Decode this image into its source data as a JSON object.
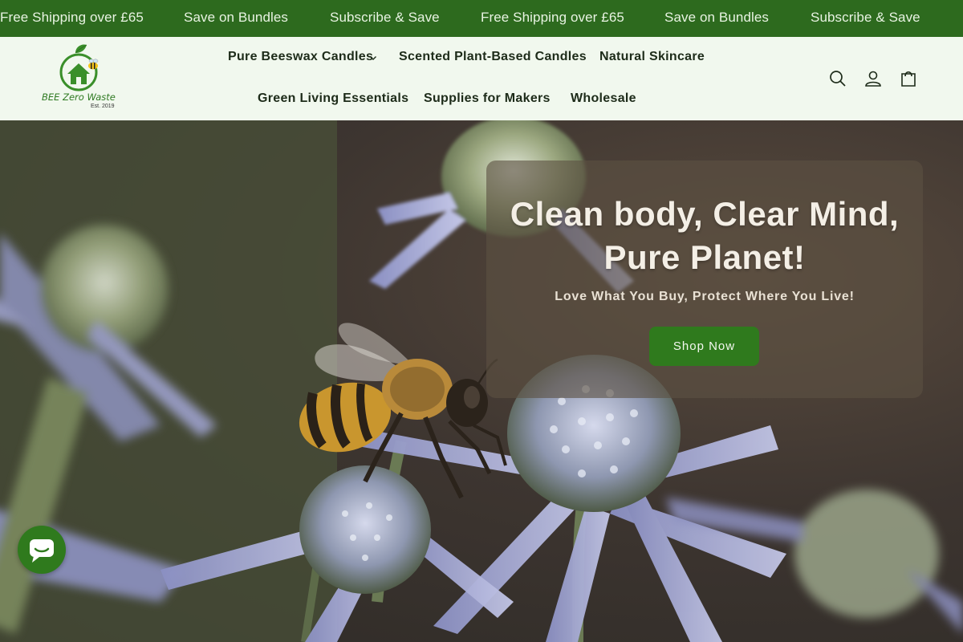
{
  "announcement": {
    "items": [
      "Free Shipping over £65",
      "Save on Bundles",
      "Subscribe & Save",
      "Free Shipping over £65",
      "Save on Bundles",
      "Subscribe & Save"
    ]
  },
  "logo": {
    "name": "BEE Zero Waste",
    "est": "Est. 2019"
  },
  "nav": {
    "row1": [
      "Pure Beeswax Candles",
      "Scented Plant-Based Candles",
      "Natural Skincare"
    ],
    "row2": [
      "Green Living Essentials",
      "Supplies for Makers",
      "Wholesale"
    ]
  },
  "header_icons": [
    "search-icon",
    "account-icon",
    "cart-icon"
  ],
  "hero": {
    "title_line1": "Clean body, Clear Mind,",
    "title_line2": "Pure Planet!",
    "subtitle": "Love What You Buy, Protect Where You Live!",
    "cta": "Shop Now"
  },
  "chat_icon": "chat-icon",
  "colors": {
    "brand_green": "#2d6a1e",
    "button_green": "#2f7a1d",
    "header_bg": "#f1f8ee"
  }
}
